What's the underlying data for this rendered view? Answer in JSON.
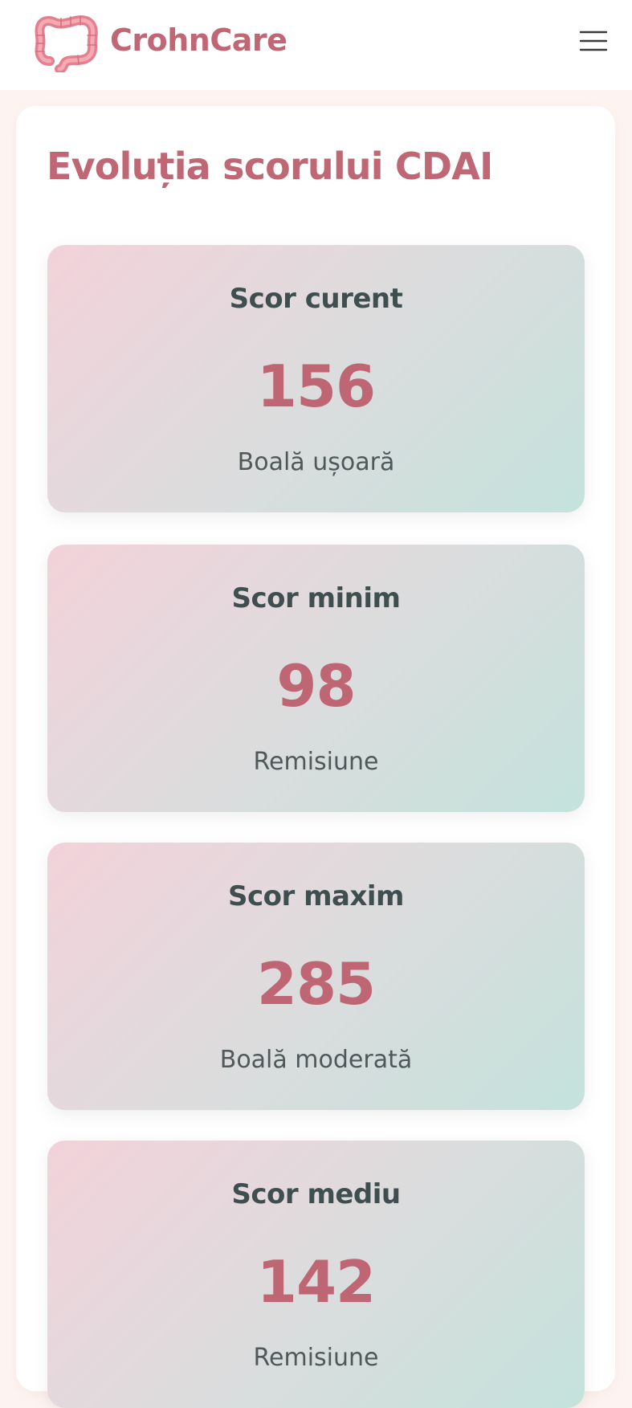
{
  "header": {
    "brand": "CrohnCare",
    "logo_icon": "intestine-icon",
    "menu_icon": "hamburger-menu-icon"
  },
  "main": {
    "title": "Evoluția scorului CDAI",
    "stats": [
      {
        "label": "Scor curent",
        "value": "156",
        "description": "Boală ușoară"
      },
      {
        "label": "Scor minim",
        "value": "98",
        "description": "Remisiune"
      },
      {
        "label": "Scor maxim",
        "value": "285",
        "description": "Boală moderată"
      },
      {
        "label": "Scor mediu",
        "value": "142",
        "description": "Remisiune"
      }
    ]
  },
  "colors": {
    "accent": "#c06776",
    "text_dark": "#3f4f4f",
    "background": "#fdf4f1",
    "gradient_pink": "#f3d2da",
    "gradient_teal": "#c4e2dc"
  }
}
